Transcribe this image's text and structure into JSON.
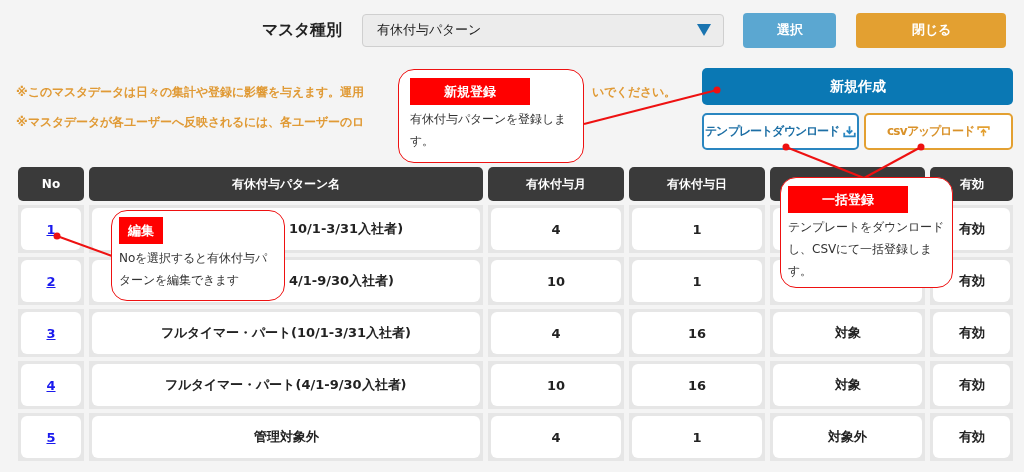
{
  "header": {
    "label": "マスタ種別",
    "select": {
      "value": "有休付与パターン"
    },
    "buttons": [
      {
        "label": "選択",
        "kind": "select"
      },
      {
        "label": "閉じる",
        "kind": "close"
      }
    ]
  },
  "notes": [
    {
      "text": "※このマスタデータは日々の集計や登録に影響を与えます。運用",
      "tail": "いでください。"
    },
    {
      "text": "※マスタデータが各ユーザーへ反映されるには、各ユーザーのロ"
    }
  ],
  "actions": {
    "create": "新規作成",
    "download": "テンプレートダウンロード",
    "upload": "csvアップロード"
  },
  "table": {
    "columns": [
      {
        "kind": "text",
        "label": "No"
      },
      {
        "kind": "text",
        "label": "有休付与パターン名"
      },
      {
        "kind": "text",
        "label": "有休付与月"
      },
      {
        "kind": "text",
        "label": "有休付与日"
      },
      {
        "kind": "blank"
      },
      {
        "kind": "text",
        "label": "有効"
      }
    ],
    "rows": [
      {
        "no": "1",
        "name": "10/1-3/31入社者)",
        "month": "4",
        "day": "1",
        "valid": "有効",
        "covered": true
      },
      {
        "no": "2",
        "name": "4/1-9/30入社者)",
        "month": "10",
        "day": "1",
        "valid": "有効",
        "covered": true
      },
      {
        "no": "3",
        "name": "フルタイマー・パート(10/1-3/31入社者)",
        "month": "4",
        "day": "16",
        "column_5": "対象",
        "valid": "有効",
        "covered": false
      },
      {
        "no": "4",
        "name": "フルタイマー・パート(4/1-9/30入社者)",
        "month": "10",
        "day": "16",
        "column_5": "対象",
        "valid": "有効",
        "covered": false
      },
      {
        "no": "5",
        "name": "管理対象外",
        "month": "4",
        "day": "1",
        "column_5": "対象外",
        "valid": "有効",
        "covered": false
      }
    ]
  },
  "callouts": [
    {
      "kind": "create",
      "title": "新規登録",
      "text": "有休付与パターンを登録します。"
    },
    {
      "kind": "bulk",
      "title": "一括登録",
      "text": "テンプレートをダウンロードし、CSVにて一括登録します。"
    },
    {
      "kind": "edit",
      "title": "編集",
      "text": "Noを選択すると有休付与パターンを編集できます"
    }
  ]
}
